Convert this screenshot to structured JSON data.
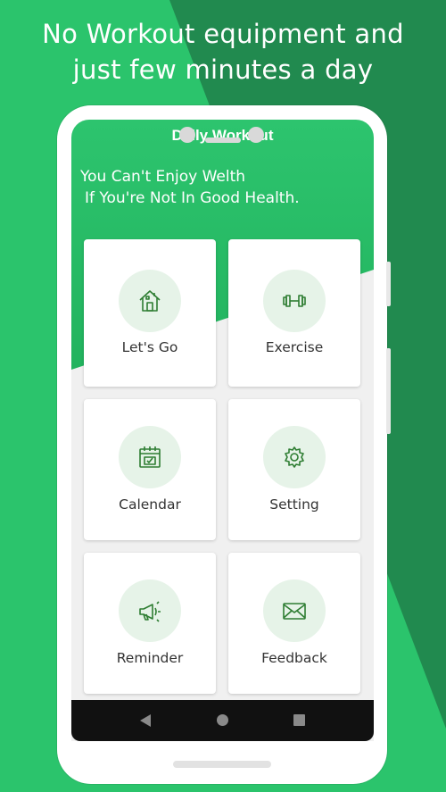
{
  "promo": {
    "line1": "No Workout equipment and",
    "line2": "just few minutes a day"
  },
  "app": {
    "title": "Daily Workout",
    "quote_line1": "You Can't Enjoy Welth",
    "quote_line2": "If You're Not In Good Health."
  },
  "menu": [
    {
      "label": "Let's Go",
      "icon": "home-icon"
    },
    {
      "label": "Exercise",
      "icon": "dumbbell-icon"
    },
    {
      "label": "Calendar",
      "icon": "calendar-icon"
    },
    {
      "label": "Setting",
      "icon": "gear-icon"
    },
    {
      "label": "Reminder",
      "icon": "megaphone-icon"
    },
    {
      "label": "Feedback",
      "icon": "mail-icon"
    }
  ],
  "nav": {
    "back_icon": "back-triangle-icon",
    "home_icon": "home-circle-icon",
    "recent_icon": "recent-square-icon"
  },
  "colors": {
    "accent": "#22b35e",
    "icon": "#2e7d32",
    "icon_bg": "#e6f3e8"
  }
}
